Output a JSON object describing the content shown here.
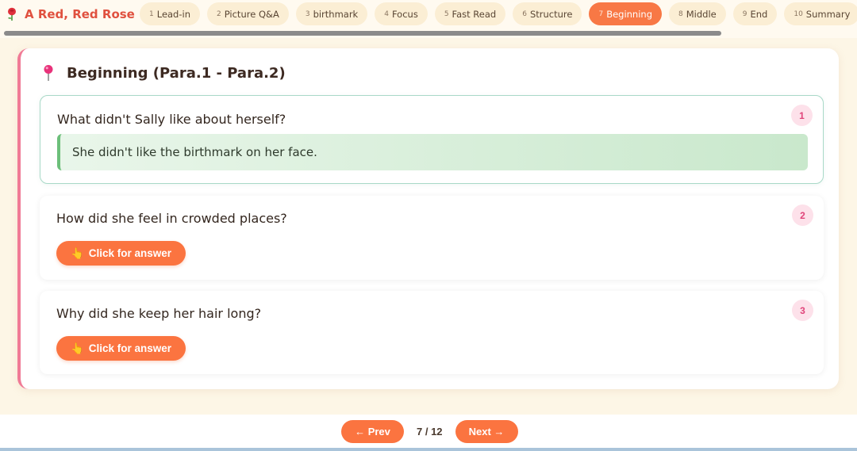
{
  "header": {
    "title": "A Red, Red Rose",
    "tabs": [
      {
        "num": "1",
        "label": "Lead-in"
      },
      {
        "num": "2",
        "label": "Picture Q&A"
      },
      {
        "num": "3",
        "label": "birthmark"
      },
      {
        "num": "4",
        "label": "Focus"
      },
      {
        "num": "5",
        "label": "Fast Read"
      },
      {
        "num": "6",
        "label": "Structure"
      },
      {
        "num": "7",
        "label": "Beginning"
      },
      {
        "num": "8",
        "label": "Middle"
      },
      {
        "num": "9",
        "label": "End"
      },
      {
        "num": "10",
        "label": "Summary"
      }
    ],
    "active_tab": 7
  },
  "section": {
    "title": "Beginning (Para.1 - Para.2)",
    "questions": [
      {
        "num": "1",
        "question": "What didn't Sally like about herself?",
        "answer": "She didn't like the birthmark on her face."
      },
      {
        "num": "2",
        "question": "How did she feel in crowded places?",
        "button": "Click for answer"
      },
      {
        "num": "3",
        "question": "Why did she keep her hair long?",
        "button": "Click for answer"
      }
    ]
  },
  "footer": {
    "prev": "← Prev",
    "next": "Next →",
    "page": "7 / 12"
  },
  "colors": {
    "accent": "#fb7440",
    "brand": "#e0513f",
    "card_border": "#f07a96",
    "answer_bar": "#6cbf7a"
  }
}
